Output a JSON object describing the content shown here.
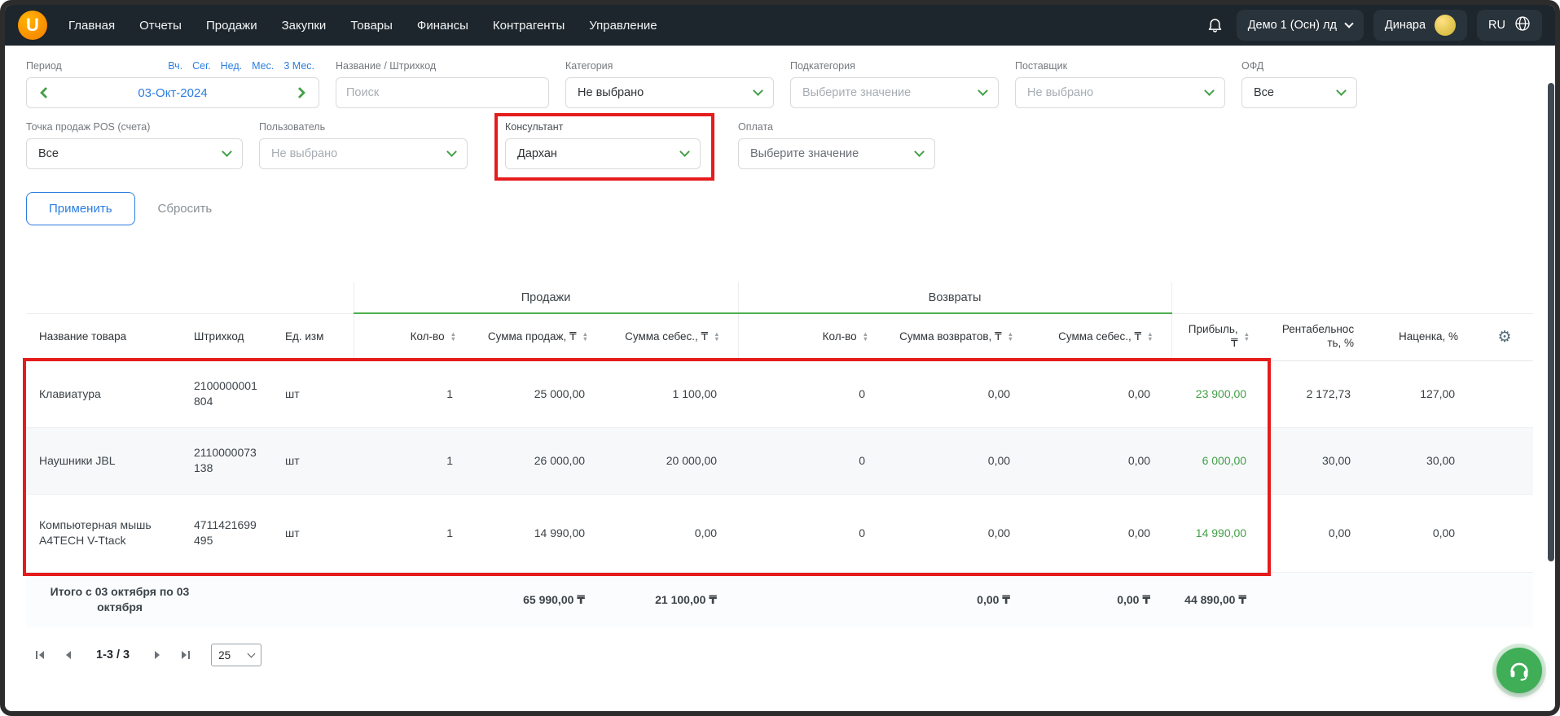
{
  "topnav": {
    "logo_letter": "U",
    "nav_items": [
      "Главная",
      "Отчеты",
      "Продажи",
      "Закупки",
      "Товары",
      "Финансы",
      "Контрагенты",
      "Управление"
    ],
    "account_selector": "Демо 1 (Осн) лд",
    "user_name": "Динара",
    "language": "RU"
  },
  "filters": {
    "period": {
      "label": "Период",
      "shortcuts": [
        "Вч.",
        "Сег.",
        "Нед.",
        "Мес.",
        "3 Мес."
      ],
      "date": "03-Окт-2024"
    },
    "search": {
      "label": "Название / Штрихкод",
      "placeholder": "Поиск"
    },
    "category": {
      "label": "Категория",
      "value": "Не выбрано"
    },
    "subcategory": {
      "label": "Подкатегория",
      "value": "Выберите значение"
    },
    "supplier": {
      "label": "Поставщик",
      "value": "Не выбрано"
    },
    "ofd": {
      "label": "ОФД",
      "value": "Все"
    },
    "pos": {
      "label": "Точка продаж POS (счета)",
      "value": "Все"
    },
    "user": {
      "label": "Пользователь",
      "value": "Не выбрано"
    },
    "consultant": {
      "label": "Консультант",
      "value": "Дархан"
    },
    "payment": {
      "label": "Оплата",
      "value": "Выберите значение"
    },
    "apply_label": "Применить",
    "reset_label": "Сбросить"
  },
  "table": {
    "group_sales": "Продажи",
    "group_returns": "Возвраты",
    "columns": {
      "name": "Название товара",
      "barcode": "Штрихкод",
      "unit": "Ед. изм",
      "qty": "Кол-во",
      "sales_sum": "Сумма продаж, ₸",
      "sales_cost": "Сумма себес., ₸",
      "ret_qty": "Кол-во",
      "ret_sum": "Сумма возвратов, ₸",
      "ret_cost": "Сумма себес., ₸",
      "profit": "Прибыль, ₸",
      "profitability": "Рентабельность, %",
      "markup": "Наценка, %"
    },
    "rows": [
      {
        "name": "Клавиатура",
        "barcode": "2100000001804",
        "unit": "шт",
        "qty": "1",
        "sales_sum": "25 000,00",
        "sales_cost": "1 100,00",
        "ret_qty": "0",
        "ret_sum": "0,00",
        "ret_cost": "0,00",
        "profit": "23 900,00",
        "profitability": "2 172,73",
        "markup": "127,00"
      },
      {
        "name": "Наушники JBL",
        "barcode": "2110000073138",
        "unit": "шт",
        "qty": "1",
        "sales_sum": "26 000,00",
        "sales_cost": "20 000,00",
        "ret_qty": "0",
        "ret_sum": "0,00",
        "ret_cost": "0,00",
        "profit": "6 000,00",
        "profitability": "30,00",
        "markup": "30,00"
      },
      {
        "name": "Компьютерная мышь A4TECH V-Ttack",
        "barcode": "4711421699495",
        "unit": "шт",
        "qty": "1",
        "sales_sum": "14 990,00",
        "sales_cost": "0,00",
        "ret_qty": "0",
        "ret_sum": "0,00",
        "ret_cost": "0,00",
        "profit": "14 990,00",
        "profitability": "0,00",
        "markup": "0,00"
      }
    ],
    "footer": {
      "label": "Итого с 03 октября по 03 октября",
      "sales_sum": "65 990,00 ₸",
      "sales_cost": "21 100,00 ₸",
      "ret_sum": "0,00 ₸",
      "ret_cost": "0,00 ₸",
      "profit": "44 890,00 ₸"
    }
  },
  "pagination": {
    "range_label": "1-3 / 3",
    "page_size": "25"
  }
}
